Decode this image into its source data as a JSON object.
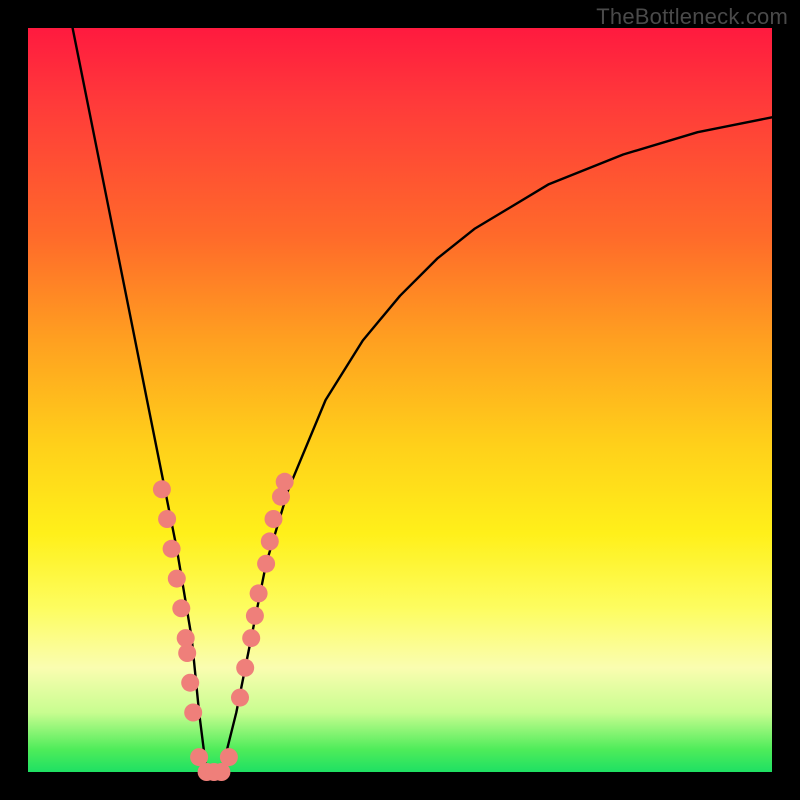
{
  "watermark": "TheBottleneck.com",
  "chart_data": {
    "type": "line",
    "title": "",
    "xlabel": "",
    "ylabel": "",
    "xlim": [
      0,
      100
    ],
    "ylim": [
      0,
      100
    ],
    "series": [
      {
        "name": "bottleneck-curve",
        "x": [
          6,
          8,
          10,
          12,
          14,
          16,
          18,
          20,
          22,
          23,
          24,
          26,
          28,
          30,
          32,
          35,
          40,
          45,
          50,
          55,
          60,
          70,
          80,
          90,
          100
        ],
        "y": [
          100,
          90,
          80,
          70,
          60,
          50,
          40,
          30,
          18,
          8,
          0,
          0,
          8,
          18,
          28,
          38,
          50,
          58,
          64,
          69,
          73,
          79,
          83,
          86,
          88
        ]
      }
    ],
    "markers": {
      "name": "highlight-points",
      "color": "#ef7f7a",
      "points": [
        {
          "x": 18.0,
          "y": 38
        },
        {
          "x": 18.7,
          "y": 34
        },
        {
          "x": 19.3,
          "y": 30
        },
        {
          "x": 20.0,
          "y": 26
        },
        {
          "x": 20.6,
          "y": 22
        },
        {
          "x": 21.2,
          "y": 18
        },
        {
          "x": 21.4,
          "y": 16
        },
        {
          "x": 21.8,
          "y": 12
        },
        {
          "x": 22.2,
          "y": 8
        },
        {
          "x": 23.0,
          "y": 2
        },
        {
          "x": 24.0,
          "y": 0
        },
        {
          "x": 25.0,
          "y": 0
        },
        {
          "x": 26.0,
          "y": 0
        },
        {
          "x": 27.0,
          "y": 2
        },
        {
          "x": 28.5,
          "y": 10
        },
        {
          "x": 29.2,
          "y": 14
        },
        {
          "x": 30.0,
          "y": 18
        },
        {
          "x": 30.5,
          "y": 21
        },
        {
          "x": 31.0,
          "y": 24
        },
        {
          "x": 32.0,
          "y": 28
        },
        {
          "x": 32.5,
          "y": 31
        },
        {
          "x": 33.0,
          "y": 34
        },
        {
          "x": 34.0,
          "y": 37
        },
        {
          "x": 34.5,
          "y": 39
        }
      ]
    },
    "gradient_stops": [
      {
        "pos": 0.0,
        "color": "#ff1a3f"
      },
      {
        "pos": 0.28,
        "color": "#ff6a2a"
      },
      {
        "pos": 0.56,
        "color": "#ffd01a"
      },
      {
        "pos": 0.78,
        "color": "#fdfd60"
      },
      {
        "pos": 0.97,
        "color": "#4eec5a"
      },
      {
        "pos": 1.0,
        "color": "#1ee063"
      }
    ]
  }
}
